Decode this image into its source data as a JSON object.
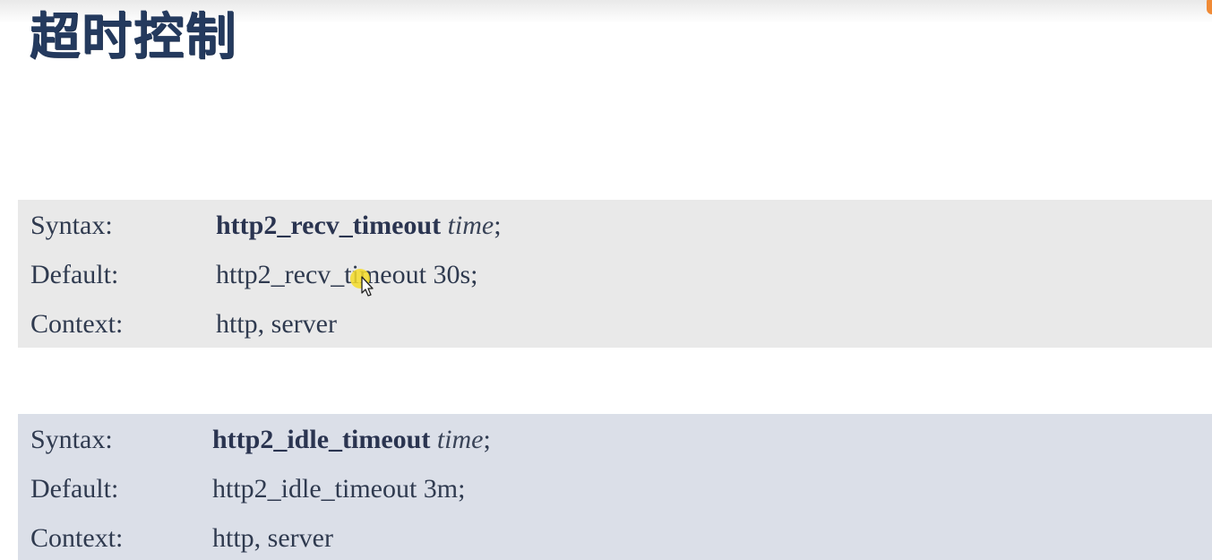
{
  "slide": {
    "title": "超时控制"
  },
  "directives": [
    {
      "syntax_label": "Syntax:",
      "directive_name": "http2_recv_timeout",
      "argument": "time",
      "terminator": ";",
      "default_label": "Default:",
      "default_value": "http2_recv_timeout 30s;",
      "context_label": "Context:",
      "context_value": "http, server"
    },
    {
      "syntax_label": "Syntax:",
      "directive_name": "http2_idle_timeout",
      "argument": "time",
      "terminator": ";",
      "default_label": "Default:",
      "default_value": "http2_idle_timeout 3m;",
      "context_label": "Context:",
      "context_value": "http, server"
    }
  ],
  "colors": {
    "title": "#243a5e",
    "box_1_background": "#e9e9e9",
    "box_2_background": "#dbdfe8",
    "cursor_highlight": "#f5dc28"
  },
  "icons": {
    "cursor": "mouse-pointer-icon"
  }
}
